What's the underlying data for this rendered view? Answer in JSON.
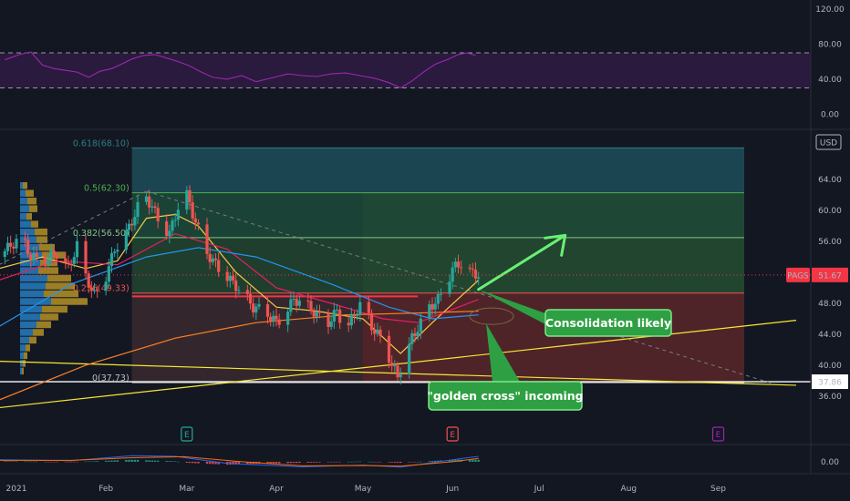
{
  "chart_data": [
    {
      "type": "line",
      "panel": "rsi",
      "ylim": [
        -10,
        125
      ],
      "y_ticks": [
        "120.00",
        "80.00",
        "40.00",
        "0.00"
      ],
      "band_levels": [
        70,
        30
      ],
      "x_date_start": "2020-12-26",
      "x_date_end": "2021-06-12",
      "series": [
        {
          "color": "#9c27b0",
          "points": [
            [
              "2020-12-28",
              62
            ],
            [
              "2021-01-02",
              68
            ],
            [
              "2021-01-06",
              71
            ],
            [
              "2021-01-10",
              56
            ],
            [
              "2021-01-14",
              52
            ],
            [
              "2021-01-18",
              50
            ],
            [
              "2021-01-22",
              48
            ],
            [
              "2021-01-26",
              42
            ],
            [
              "2021-01-30",
              49
            ],
            [
              "2021-02-03",
              52
            ],
            [
              "2021-02-07",
              58
            ],
            [
              "2021-02-10",
              63
            ],
            [
              "2021-02-14",
              67
            ],
            [
              "2021-02-18",
              68
            ],
            [
              "2021-02-22",
              64
            ],
            [
              "2021-02-26",
              60
            ],
            [
              "2021-03-02",
              55
            ],
            [
              "2021-03-06",
              48
            ],
            [
              "2021-03-10",
              42
            ],
            [
              "2021-03-15",
              40
            ],
            [
              "2021-03-20",
              44
            ],
            [
              "2021-03-25",
              37
            ],
            [
              "2021-03-30",
              41
            ],
            [
              "2021-04-05",
              46
            ],
            [
              "2021-04-10",
              44
            ],
            [
              "2021-04-15",
              43
            ],
            [
              "2021-04-20",
              46
            ],
            [
              "2021-04-25",
              47
            ],
            [
              "2021-04-30",
              44
            ],
            [
              "2021-05-05",
              41
            ],
            [
              "2021-05-10",
              36
            ],
            [
              "2021-05-14",
              30
            ],
            [
              "2021-05-18",
              38
            ],
            [
              "2021-05-22",
              48
            ],
            [
              "2021-05-26",
              57
            ],
            [
              "2021-05-30",
              62
            ],
            [
              "2021-06-03",
              68
            ],
            [
              "2021-06-06",
              70
            ],
            [
              "2021-06-09",
              67
            ]
          ]
        }
      ]
    },
    {
      "type": "candlestick",
      "panel": "price",
      "symbol": "PAGS",
      "currency": "USD",
      "last_price": "51.67",
      "ylim": [
        34.8,
        69.8
      ],
      "y_ticks": [
        "64.00",
        "60.00",
        "56.00",
        "52.00",
        "48.00",
        "44.00",
        "40.00",
        "36.00"
      ],
      "x_labels": [
        {
          "date": "2021-01-01",
          "label": "2021"
        },
        {
          "date": "2021-02-01",
          "label": "Feb"
        },
        {
          "date": "2021-03-01",
          "label": "Mar"
        },
        {
          "date": "2021-04-01",
          "label": "Apr"
        },
        {
          "date": "2021-05-01",
          "label": "May"
        },
        {
          "date": "2021-06-01",
          "label": "Jun"
        },
        {
          "date": "2021-07-01",
          "label": "Jul"
        },
        {
          "date": "2021-08-01",
          "label": "Aug"
        },
        {
          "date": "2021-09-01",
          "label": "Sep"
        }
      ],
      "price_points": [
        [
          "2020-12-26",
          54.0
        ],
        [
          "2020-12-30",
          55.5
        ],
        [
          "2021-01-03",
          56.5
        ],
        [
          "2021-01-06",
          54.0
        ],
        [
          "2021-01-10",
          53.5
        ],
        [
          "2021-01-15",
          54.5
        ],
        [
          "2021-01-19",
          52.5
        ],
        [
          "2021-01-22",
          55.5
        ],
        [
          "2021-01-25",
          51.5
        ],
        [
          "2021-01-28",
          49.0
        ],
        [
          "2021-02-01",
          51.5
        ],
        [
          "2021-02-04",
          55.0
        ],
        [
          "2021-02-08",
          57.0
        ],
        [
          "2021-02-11",
          59.5
        ],
        [
          "2021-02-14",
          62.3
        ],
        [
          "2021-02-17",
          60.5
        ],
        [
          "2021-02-20",
          58.0
        ],
        [
          "2021-02-23",
          57.0
        ],
        [
          "2021-02-26",
          60.5
        ],
        [
          "2021-03-01",
          62.0
        ],
        [
          "2021-03-04",
          58.5
        ],
        [
          "2021-03-08",
          54.5
        ],
        [
          "2021-03-12",
          52.5
        ],
        [
          "2021-03-16",
          51.0
        ],
        [
          "2021-03-20",
          49.5
        ],
        [
          "2021-03-24",
          47.5
        ],
        [
          "2021-03-28",
          47.0
        ],
        [
          "2021-04-01",
          45.5
        ],
        [
          "2021-04-04",
          46.5
        ],
        [
          "2021-04-07",
          48.5
        ],
        [
          "2021-04-11",
          48.0
        ],
        [
          "2021-04-15",
          46.5
        ],
        [
          "2021-04-19",
          45.5
        ],
        [
          "2021-04-22",
          47.0
        ],
        [
          "2021-04-25",
          44.5
        ],
        [
          "2021-04-28",
          46.5
        ],
        [
          "2021-05-01",
          48.5
        ],
        [
          "2021-05-04",
          45.0
        ],
        [
          "2021-05-08",
          43.0
        ],
        [
          "2021-05-11",
          40.0
        ],
        [
          "2021-05-13",
          38.5
        ],
        [
          "2021-05-15",
          40.5
        ],
        [
          "2021-05-18",
          43.5
        ],
        [
          "2021-05-21",
          45.5
        ],
        [
          "2021-05-24",
          47.5
        ],
        [
          "2021-05-27",
          48.5
        ],
        [
          "2021-05-30",
          50.5
        ],
        [
          "2021-06-01",
          52.5
        ],
        [
          "2021-06-04",
          53.2
        ],
        [
          "2021-06-07",
          52.0
        ],
        [
          "2021-06-10",
          51.67
        ]
      ],
      "moving_averages": [
        {
          "color": "#f7c948",
          "points": [
            [
              "2020-12-26",
              52.5
            ],
            [
              "2021-01-10",
              54.0
            ],
            [
              "2021-01-25",
              52.5
            ],
            [
              "2021-02-05",
              53.5
            ],
            [
              "2021-02-15",
              59.0
            ],
            [
              "2021-02-25",
              59.5
            ],
            [
              "2021-03-05",
              58.0
            ],
            [
              "2021-03-18",
              52.0
            ],
            [
              "2021-04-01",
              47.5
            ],
            [
              "2021-04-15",
              47.0
            ],
            [
              "2021-05-01",
              46.0
            ],
            [
              "2021-05-14",
              41.5
            ],
            [
              "2021-05-25",
              45.5
            ],
            [
              "2021-06-10",
              51.0
            ]
          ]
        },
        {
          "color": "#e91e63",
          "points": [
            [
              "2020-12-26",
              51.0
            ],
            [
              "2021-01-15",
              53.5
            ],
            [
              "2021-02-05",
              53.0
            ],
            [
              "2021-02-25",
              57.0
            ],
            [
              "2021-03-15",
              55.0
            ],
            [
              "2021-04-01",
              50.0
            ],
            [
              "2021-04-20",
              48.0
            ],
            [
              "2021-05-08",
              46.0
            ],
            [
              "2021-05-20",
              45.5
            ],
            [
              "2021-06-10",
              48.5
            ]
          ]
        },
        {
          "color": "#2196f3",
          "points": [
            [
              "2020-12-26",
              45.0
            ],
            [
              "2021-01-20",
              50.5
            ],
            [
              "2021-02-15",
              54.0
            ],
            [
              "2021-03-05",
              55.2
            ],
            [
              "2021-03-25",
              54.0
            ],
            [
              "2021-04-20",
              50.5
            ],
            [
              "2021-05-10",
              47.5
            ],
            [
              "2021-05-25",
              46.0
            ],
            [
              "2021-06-10",
              46.5
            ]
          ]
        },
        {
          "color": "#ff7f27",
          "points": [
            [
              "2020-12-26",
              35.5
            ],
            [
              "2021-01-25",
              40.0
            ],
            [
              "2021-02-25",
              43.5
            ],
            [
              "2021-03-25",
              45.5
            ],
            [
              "2021-04-25",
              46.5
            ],
            [
              "2021-05-25",
              46.8
            ],
            [
              "2021-06-10",
              47.0
            ]
          ]
        }
      ],
      "fib_levels": [
        {
          "label": "0.618(68.10)",
          "value": 68.1,
          "color": "#2e7d83"
        },
        {
          "label": "0.5(62.30)",
          "value": 62.3,
          "color": "#4caf50"
        },
        {
          "label": "0.382(56.50)",
          "value": 56.5,
          "color": "#81c784"
        },
        {
          "label": "0.236(49.33)",
          "value": 49.33,
          "color": "#ef5350"
        },
        {
          "label": "0(37.73)",
          "value": 37.73,
          "color": "#bdbdbd"
        }
      ],
      "fib_range": {
        "start": "2021-02-10",
        "end": "2021-09-10"
      },
      "horizontal_lines": [
        {
          "value": 37.86,
          "label": "37.86",
          "color": "#ffffff"
        },
        {
          "value": 48.9,
          "color": "#f23645",
          "start": "2021-02-10",
          "end": "2021-05-20"
        }
      ],
      "trend_lines": [
        {
          "color": "#f7e733",
          "from": [
            "2020-12-26",
            40.5
          ],
          "to": [
            "2021-09-28",
            37.4
          ]
        },
        {
          "color": "#f7e733",
          "from": [
            "2020-12-26",
            34.5
          ],
          "to": [
            "2021-09-28",
            45.8
          ]
        },
        {
          "color": "#787b86",
          "dashed": true,
          "from": [
            "2021-02-15",
            62.5
          ],
          "to": [
            "2021-09-20",
            37.6
          ]
        },
        {
          "color": "#787b86",
          "dashed": true,
          "from": [
            "2020-12-26",
            53.0
          ],
          "to": [
            "2021-02-15",
            62.5
          ]
        }
      ],
      "annotations": [
        {
          "text": "Consolidation likely",
          "anchor": [
            "2021-06-10",
            49.8
          ]
        },
        {
          "text": "\"golden cross\" incoming",
          "anchor": [
            "2021-06-12",
            46.8
          ]
        }
      ],
      "arrow_up": {
        "from": [
          "2021-06-10",
          49.8
        ],
        "to": [
          "2021-07-10",
          56.8
        ]
      },
      "events": [
        {
          "date": "2021-03-01",
          "label": "E",
          "color": "#26a69a"
        },
        {
          "date": "2021-06-01",
          "label": "E",
          "color": "#ef5350"
        },
        {
          "date": "2021-09-01",
          "label": "E",
          "color": "#9c27b0"
        }
      ],
      "volume_profile": [
        {
          "price": 63.2,
          "up": 3,
          "down": 5
        },
        {
          "price": 62.2,
          "up": 6,
          "down": 9
        },
        {
          "price": 61.2,
          "up": 8,
          "down": 10
        },
        {
          "price": 60.2,
          "up": 10,
          "down": 9
        },
        {
          "price": 59.2,
          "up": 7,
          "down": 6
        },
        {
          "price": 58.2,
          "up": 12,
          "down": 8
        },
        {
          "price": 57.2,
          "up": 16,
          "down": 14
        },
        {
          "price": 56.2,
          "up": 18,
          "down": 12
        },
        {
          "price": 55.2,
          "up": 21,
          "down": 17
        },
        {
          "price": 54.2,
          "up": 24,
          "down": 26
        },
        {
          "price": 53.2,
          "up": 22,
          "down": 19
        },
        {
          "price": 52.2,
          "up": 20,
          "down": 22
        },
        {
          "price": 51.2,
          "up": 30,
          "down": 26
        },
        {
          "price": 50.2,
          "up": 28,
          "down": 32
        },
        {
          "price": 49.2,
          "up": 26,
          "down": 38
        },
        {
          "price": 48.2,
          "up": 34,
          "down": 40
        },
        {
          "price": 47.2,
          "up": 24,
          "down": 28
        },
        {
          "price": 46.2,
          "up": 22,
          "down": 20
        },
        {
          "price": 45.2,
          "up": 18,
          "down": 16
        },
        {
          "price": 44.2,
          "up": 14,
          "down": 12
        },
        {
          "price": 43.2,
          "up": 10,
          "down": 8
        },
        {
          "price": 42.2,
          "up": 6,
          "down": 5
        },
        {
          "price": 41.2,
          "up": 4,
          "down": 4
        },
        {
          "price": 40.2,
          "up": 3,
          "down": 3
        },
        {
          "price": 39.2,
          "up": 2,
          "down": 2
        }
      ]
    },
    {
      "type": "histogram",
      "panel": "macd",
      "ylim": [
        -3,
        3.5
      ],
      "y_ticks": [
        "0.00"
      ],
      "macd_points": [
        [
          "2020-12-26",
          0.6
        ],
        [
          "2021-01-20",
          0.3
        ],
        [
          "2021-02-10",
          1.8
        ],
        [
          "2021-02-25",
          1.6
        ],
        [
          "2021-03-15",
          -0.5
        ],
        [
          "2021-04-10",
          -1.5
        ],
        [
          "2021-05-01",
          -1.0
        ],
        [
          "2021-05-14",
          -1.6
        ],
        [
          "2021-06-01",
          0.6
        ],
        [
          "2021-06-10",
          1.6
        ]
      ],
      "signal_points": [
        [
          "2020-12-26",
          0.4
        ],
        [
          "2021-01-20",
          0.4
        ],
        [
          "2021-02-10",
          1.2
        ],
        [
          "2021-02-28",
          1.5
        ],
        [
          "2021-03-20",
          0.0
        ],
        [
          "2021-04-10",
          -1.2
        ],
        [
          "2021-05-01",
          -1.1
        ],
        [
          "2021-05-14",
          -1.3
        ],
        [
          "2021-06-01",
          0.0
        ],
        [
          "2021-06-10",
          1.0
        ]
      ]
    }
  ]
}
